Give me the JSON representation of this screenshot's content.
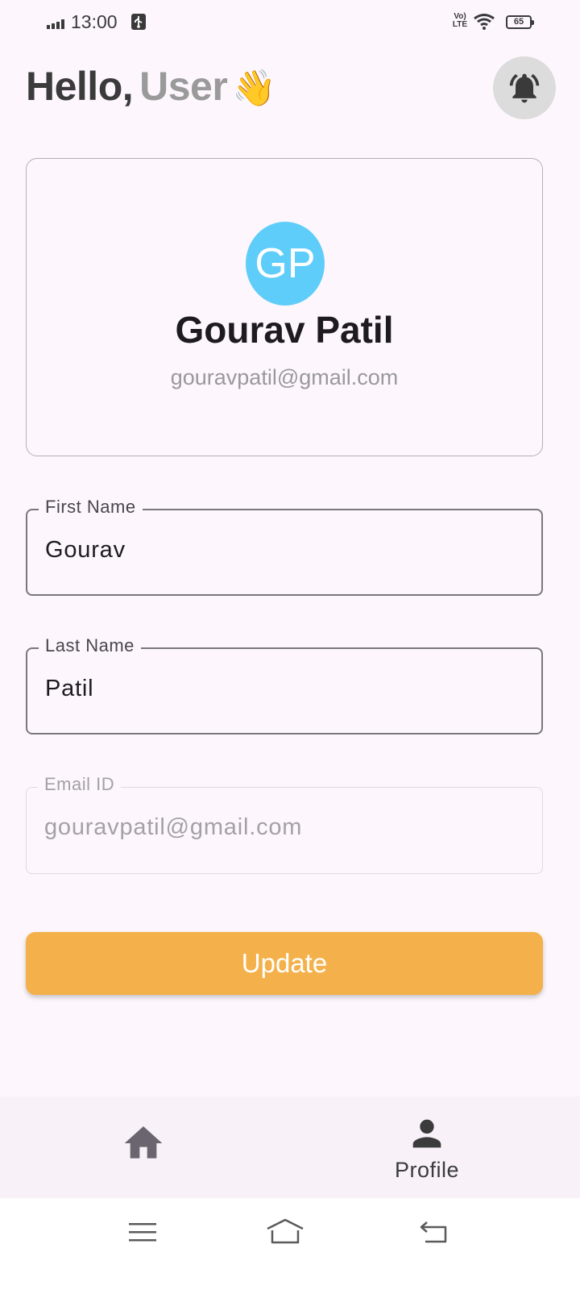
{
  "status_bar": {
    "time": "13:00",
    "network_label": "Vo)) LTE",
    "battery": "65",
    "icons": [
      "signal-icon",
      "usb-icon",
      "volte-icon",
      "wifi-icon",
      "battery-icon"
    ]
  },
  "header": {
    "hello": "Hello,",
    "user": "User",
    "wave_emoji": "👋",
    "bell_icon": "bell-ringing-icon"
  },
  "profile_card": {
    "initials": "GP",
    "name": "Gourav Patil",
    "email": "gouravpatil@gmail.com",
    "avatar_color": "#5fcdf9"
  },
  "form": {
    "first_name": {
      "label": "First Name",
      "value": "Gourav"
    },
    "last_name": {
      "label": "Last Name",
      "value": "Patil"
    },
    "email": {
      "label": "Email ID",
      "value": "gouravpatil@gmail.com"
    }
  },
  "update_button": {
    "label": "Update",
    "color": "#f4b14b"
  },
  "bottom_nav": {
    "items": [
      {
        "icon": "home-icon",
        "label": ""
      },
      {
        "icon": "person-icon",
        "label": "Profile"
      }
    ]
  },
  "system_nav": {
    "icons": [
      "menu-icon",
      "home-outline-icon",
      "back-icon"
    ]
  }
}
